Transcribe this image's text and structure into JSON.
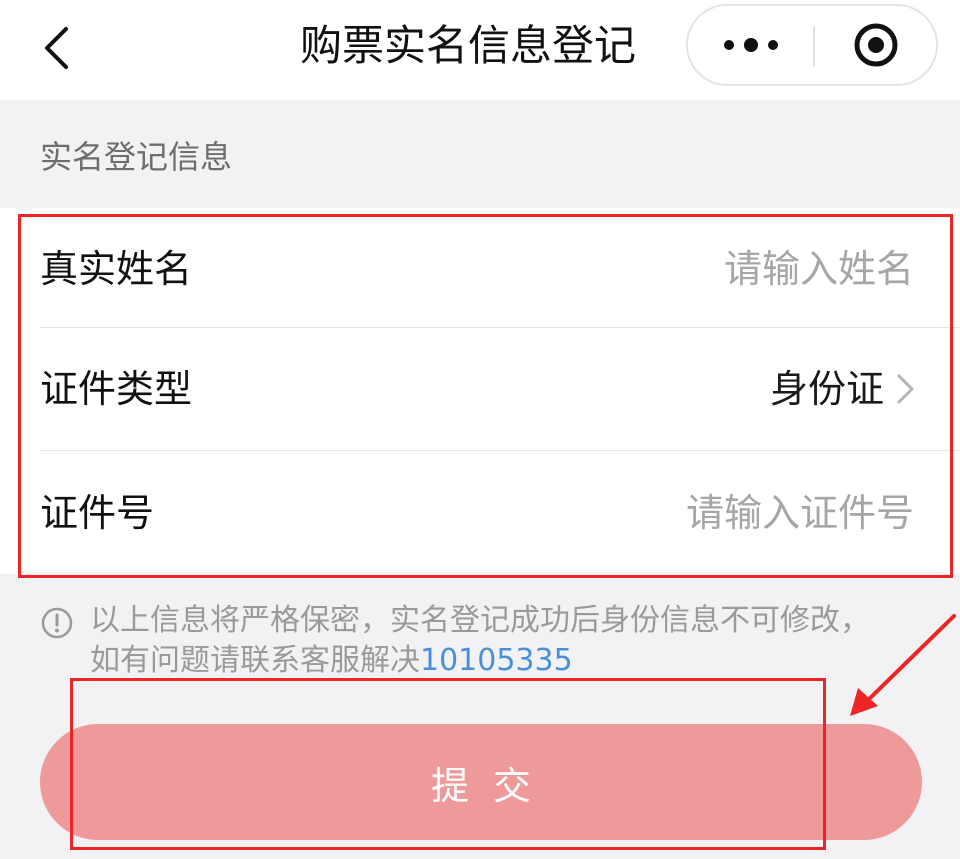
{
  "navbar": {
    "title": "购票实名信息登记",
    "back_icon": "chevron-left-icon",
    "more_icon": "more-dots-icon",
    "close_icon": "target-circle-icon"
  },
  "section": {
    "label": "实名登记信息"
  },
  "form": {
    "name": {
      "label": "真实姓名",
      "value": "",
      "placeholder": "请输入姓名"
    },
    "id_type": {
      "label": "证件类型",
      "value": "身份证",
      "icon": "chevron-right-icon"
    },
    "id_number": {
      "label": "证件号",
      "value": "",
      "placeholder": "请输入证件号"
    }
  },
  "notice": {
    "icon": "info-circle-icon",
    "line1": "以上信息将严格保密，实名登记成功后身份信息不可修改，",
    "line2_prefix": "如有问题请联系客服解决",
    "phone": "10105335"
  },
  "submit": {
    "label": "提交"
  },
  "colors": {
    "annotation": "#ee2525",
    "submit_bg": "#ee9a9a",
    "link": "#4a90d9",
    "page_bg": "#f2f2f5"
  }
}
